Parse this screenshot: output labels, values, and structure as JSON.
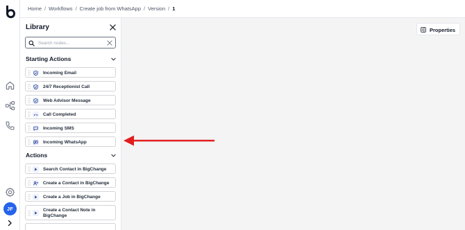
{
  "user": {
    "initials": "JF",
    "avatar_color": "#2563eb"
  },
  "breadcrumb": {
    "items": [
      "Home",
      "Workflows",
      "Create job from WhatsApp",
      "Version"
    ],
    "current": "1",
    "separator": "/"
  },
  "library": {
    "title": "Library",
    "search": {
      "placeholder": "Search nodes...",
      "value": ""
    },
    "sections": [
      {
        "title": "Starting Actions",
        "nodes": [
          {
            "label": "Incoming Email",
            "icon": "shield-check-icon"
          },
          {
            "label": "24/7 Receptionist Call",
            "icon": "shield-check-icon"
          },
          {
            "label": "Web Advisor Message",
            "icon": "shield-check-icon"
          },
          {
            "label": "Call Completed",
            "icon": "phone-hangup-icon"
          },
          {
            "label": "Incoming SMS",
            "icon": "message-square-icon"
          },
          {
            "label": "Incoming WhatsApp",
            "icon": "message-text-icon"
          }
        ]
      },
      {
        "title": "Actions",
        "nodes": [
          {
            "label": "Search Contact in BigChange",
            "icon": "play-icon"
          },
          {
            "label": "Create a Contact in BigChange",
            "icon": "user-plus-icon"
          },
          {
            "label": "Create a Job in BigChange",
            "icon": "play-icon"
          },
          {
            "label": "Create a Contact Note in BigChange",
            "icon": "play-icon"
          }
        ]
      }
    ]
  },
  "canvas": {
    "properties_label": "Properties"
  },
  "colors": {
    "accent": "#2563eb",
    "annotation_arrow": "#e11d1d",
    "node_icon_bg": "#eef2ff"
  }
}
